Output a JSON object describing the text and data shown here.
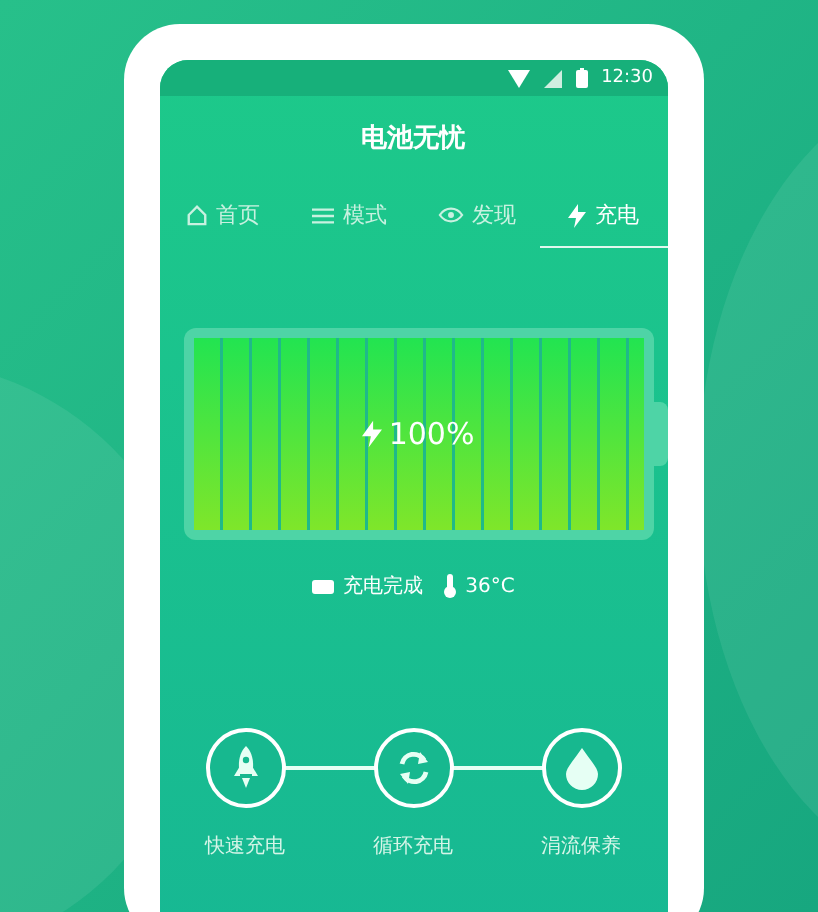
{
  "status_bar": {
    "time": "12:30"
  },
  "title": "电池无忧",
  "tabs": [
    {
      "label": "首页",
      "selected": false
    },
    {
      "label": "模式",
      "selected": false
    },
    {
      "label": "发现",
      "selected": false
    },
    {
      "label": "充电",
      "selected": true
    }
  ],
  "battery": {
    "level": 1,
    "reading": "100%"
  },
  "status": {
    "text": "充电完成",
    "temperature": "36°C"
  },
  "steps": [
    {
      "kind": "rocket",
      "label": "快速充电"
    },
    {
      "kind": "cycle",
      "label": "循环充电"
    },
    {
      "kind": "drop",
      "label": "涓流保养"
    }
  ]
}
